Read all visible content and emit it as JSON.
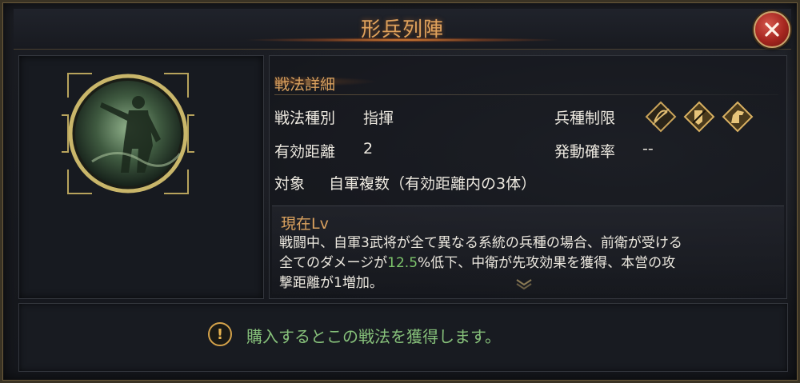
{
  "window": {
    "title": "形兵列陣"
  },
  "close_button": {
    "icon": "close-icon"
  },
  "detail": {
    "section_title": "戦法詳細",
    "type_label": "戦法種別",
    "type_value": "指揮",
    "troop_label": "兵種制限",
    "troop_icons": [
      "archer-troop-icon",
      "infantry-troop-icon",
      "cavalry-troop-icon"
    ],
    "range_label": "有効距離",
    "range_value": "2",
    "chance_label": "発動確率",
    "chance_value": "--",
    "target_label": "対象",
    "target_value": "自軍複数（有効距離内の3体）"
  },
  "level": {
    "title": "現在Lv",
    "desc_line1": "戦闘中、自軍3武将が全て異なる系統の兵種の場合、前衛が受ける",
    "desc_line2_before": "全てのダメージが",
    "desc_highlight": "12.5",
    "desc_line2_after": "%低下、中衛が先攻効果を獲得、本営の攻",
    "desc_line3": "撃距離が1増加。"
  },
  "info": {
    "icon_text": "!",
    "text": "購入するとこの戦法を獲得します。"
  },
  "colors": {
    "accent_gold": "#d8a05e",
    "highlight_green": "#7cc36b",
    "info_green": "#86c07a",
    "close_red": "#a5261f"
  }
}
